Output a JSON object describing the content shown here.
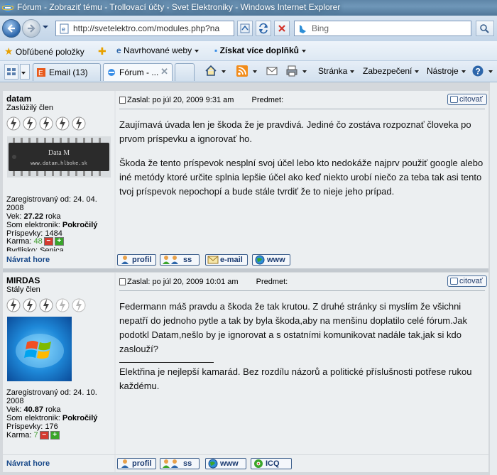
{
  "window": {
    "title": "Fórum - Zobraziť tému - Trollovací účty - Svet Elektroniky - Windows Internet Explorer"
  },
  "address_bar": {
    "url": "http://svetelektro.com/modules.php?na",
    "search_placeholder": "Bing"
  },
  "favorites_bar": {
    "favorites_label": "Obľúbené položky",
    "suggested_label": "Navrhované weby",
    "addons_label": "Získat více doplňků"
  },
  "tabs": [
    {
      "label": "Email (13)"
    },
    {
      "label": "Fórum - ..."
    }
  ],
  "command_bar": {
    "page_label": "Stránka",
    "safety_label": "Zabezpečení",
    "tools_label": "Nástroje"
  },
  "posts": [
    {
      "author": "datam",
      "rank": "Zaslúžilý člen",
      "avatar_text": "Data M",
      "avatar_url_text": "www.datam.hlboke.sk",
      "registered": "Zaregistrovaný od: 24. 04. 2008",
      "age_label": "Vek:",
      "age": "27.22",
      "age_unit": "roka",
      "level_label": "Som elektronik:",
      "level": "Pokročilý",
      "posts_label": "Príspevky:",
      "posts_count": "1484",
      "karma_label": "Karma:",
      "karma": "48",
      "location": "Bydlisko: Senica",
      "date": "Zaslal: po júl 20, 2009 9:31 am",
      "subject_label": "Predmet:",
      "quote_label": "citovať",
      "paragraphs": [
        "Zaujímavá úvada len je škoda že je pravdivá. Jediné čo zostáva rozpoznať človeka po prvom príspevku a ignorovať ho.",
        "Škoda že tento príspevok nesplní svoj účel lebo kto nedokáže najprv použiť google alebo iné metódy ktoré určite splnia lepšie účel ako keď niekto urobí niečo za teba tak asi tento tvoj príspevok nepochopí a bude stále tvrdiť že to nieje jeho prípad."
      ],
      "signature": "",
      "back_to_top": "Návrat hore",
      "buttons": [
        "profil",
        "ss",
        "e-mail",
        "www"
      ]
    },
    {
      "author": "MIRDAS",
      "rank": "Stály člen",
      "registered": "Zaregistrovaný od: 24. 10. 2008",
      "age_label": "Vek:",
      "age": "40.87",
      "age_unit": "roka",
      "level_label": "Som elektronik:",
      "level": "Pokročilý",
      "posts_label": "Príspevky:",
      "posts_count": "176",
      "karma_label": "Karma:",
      "karma": "7",
      "date": "Zaslal: po júl 20, 2009 10:01 am",
      "subject_label": "Predmet:",
      "quote_label": "citovať",
      "paragraphs": [
        "Federmann máš pravdu a škoda že tak krutou. Z druhé stránky si myslím že všichni nepatří do jednoho pytle a tak by byla škoda,aby na menšinu doplatilo celé fórum.Jak podotkl Datam,nešlo by je ignorovat a s ostatními komunikovat nadále tak,jak si kdo zaslouží?"
      ],
      "signature": "Elektřina je nejlepší kamarád. Bez rozdílu názorů a politické příslušnosti potřese rukou každému.",
      "back_to_top": "Návrat hore",
      "buttons": [
        "profil",
        "ss",
        "www",
        "ICQ"
      ]
    }
  ],
  "colors": {
    "title_bar": "#5f86a8",
    "post_bg": "#eceff1",
    "link": "#1a4a8a",
    "karma_positive": "#3a9a2a"
  }
}
